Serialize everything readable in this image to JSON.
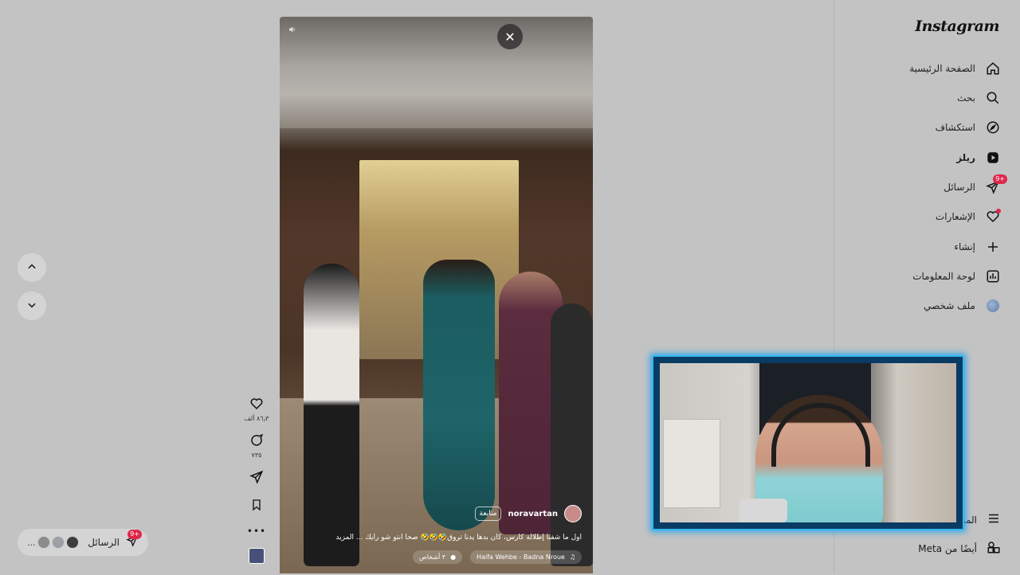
{
  "sidebar": {
    "brand": "Instagram",
    "items": [
      {
        "label": "الصفحة الرئيسية",
        "icon": "home-icon"
      },
      {
        "label": "بحث",
        "icon": "search-icon"
      },
      {
        "label": "استكشاف",
        "icon": "compass-icon"
      },
      {
        "label": "ريلز",
        "icon": "reels-icon"
      },
      {
        "label": "الرسائل",
        "icon": "messages-icon",
        "badge": "+9"
      },
      {
        "label": "الإشعارات",
        "icon": "heart-icon"
      },
      {
        "label": "إنشاء",
        "icon": "plus-icon"
      },
      {
        "label": "لوحة المعلومات",
        "icon": "dashboard-icon"
      },
      {
        "label": "ملف شخصي",
        "icon": "avatar-icon"
      }
    ],
    "more_label": "المزيد",
    "meta_label": "أيضًا من Meta"
  },
  "reel": {
    "username": "noravartan",
    "follow_label": "متابعة",
    "caption": "اول ما شفنا إطلالة كارس، كان بدها يدنا تروق🤣🤣🤣 صحا انتو شو رأيك ... المزيد",
    "tagged": "٣ أشخاص",
    "audio": "Haifa Wehbe - Badna Nroue"
  },
  "actions": {
    "likes": "٨٦٫٣ ألف",
    "comments": "٧٣٥"
  },
  "messages_pill": {
    "label": "الرسائل",
    "badge": "+9",
    "more": "..."
  },
  "colors": {
    "badge": "#e0274b",
    "webcam_border": "#35b9f5"
  }
}
